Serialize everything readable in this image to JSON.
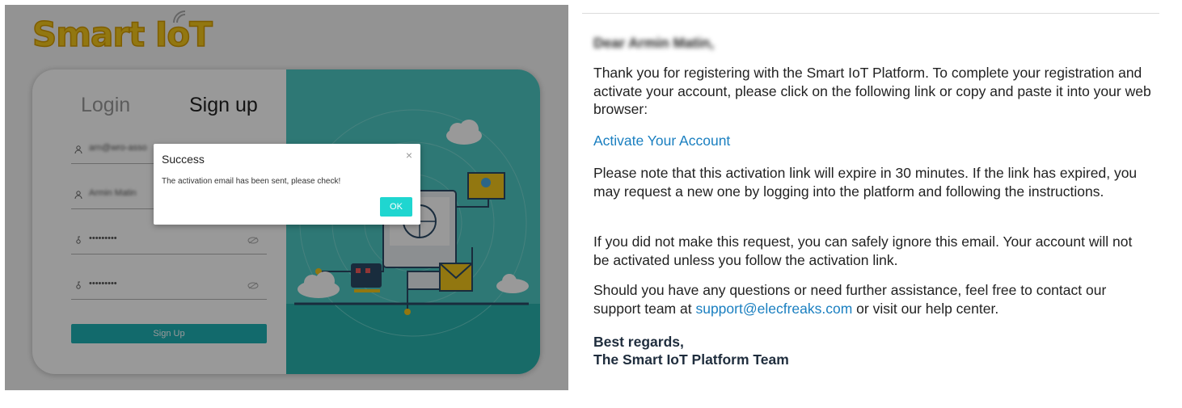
{
  "brand": {
    "logo_text": "Smart IoT"
  },
  "auth": {
    "tab_login": "Login",
    "tab_signup": "Sign up",
    "email_value": "arn@wro-asso",
    "name_value": "Armin Matin",
    "password_mask": "•••••••••",
    "confirm_mask": "•••••••••",
    "signup_button": "Sign Up"
  },
  "dialog": {
    "title": "Success",
    "close": "×",
    "message": "The activation email has been sent, please check!",
    "ok_label": "OK"
  },
  "email": {
    "greeting": "Dear Armin Matin,",
    "paragraph_1": "Thank you for registering with the Smart IoT Platform. To complete your registration and activate your account, please click on the following link or copy and paste it into your web browser:",
    "activate_link": "Activate Your Account",
    "paragraph_2": "Please note that this activation link will expire in 30 minutes. If the link has expired, you may request a new one by logging into the platform and following the instructions.",
    "paragraph_3": "If you did not make this request, you can safely ignore this email. Your account will not be activated unless you follow the activation link.",
    "paragraph_4_before": "Should you have any questions or need further assistance, feel free to contact our support team at ",
    "support_email": "support@elecfreaks.com",
    "paragraph_4_after": " or visit our help center.",
    "sign_off": "Best regards,",
    "signature": "The Smart IoT Platform Team"
  },
  "colors": {
    "accent": "#1fb1b5",
    "link": "#1a7fc0",
    "logo": "#f3c61c",
    "illustration_bg": "#4ec9c3"
  }
}
